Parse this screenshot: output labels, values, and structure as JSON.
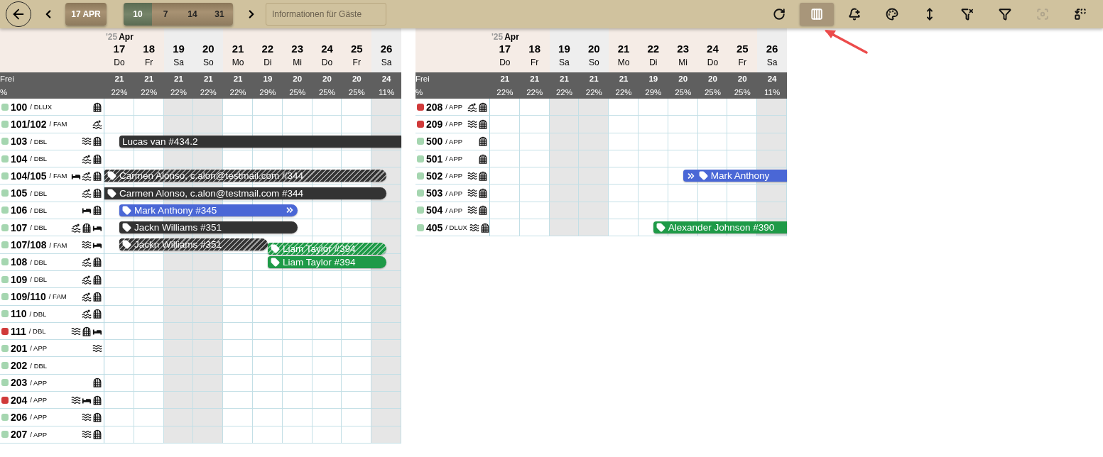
{
  "toolbar": {
    "date_button": "17 APR",
    "ranges": [
      {
        "label": "10",
        "selected": true
      },
      {
        "label": "7",
        "selected": false
      },
      {
        "label": "14",
        "selected": false
      },
      {
        "label": "31",
        "selected": false
      }
    ],
    "search": {
      "placeholder": "Informationen für Gäste"
    },
    "tools": [
      {
        "kind": "refresh",
        "selected": false,
        "disabled": false
      },
      {
        "kind": "columns",
        "selected": true,
        "disabled": false
      },
      {
        "kind": "bell-plus",
        "selected": false,
        "disabled": false
      },
      {
        "kind": "palette",
        "selected": false,
        "disabled": false
      },
      {
        "kind": "height",
        "selected": false,
        "disabled": false
      },
      {
        "kind": "filter-off",
        "selected": false,
        "disabled": false
      },
      {
        "kind": "filter",
        "selected": false,
        "disabled": false
      },
      {
        "kind": "focus",
        "selected": false,
        "disabled": true
      },
      {
        "kind": "replace",
        "selected": false,
        "disabled": false
      }
    ]
  },
  "calendars": [
    {
      "year": "'25",
      "month": "Apr",
      "free_label": "Frei",
      "percent_label": "%",
      "days": [
        {
          "date": "17",
          "weekday": "Do",
          "weekend": false,
          "free": "21",
          "percent": "22%"
        },
        {
          "date": "18",
          "weekday": "Fr",
          "weekend": false,
          "free": "21",
          "percent": "22%"
        },
        {
          "date": "19",
          "weekday": "Sa",
          "weekend": true,
          "free": "21",
          "percent": "22%"
        },
        {
          "date": "20",
          "weekday": "So",
          "weekend": true,
          "free": "21",
          "percent": "22%"
        },
        {
          "date": "21",
          "weekday": "Mo",
          "weekend": false,
          "free": "21",
          "percent": "22%"
        },
        {
          "date": "22",
          "weekday": "Di",
          "weekend": false,
          "free": "19",
          "percent": "29%"
        },
        {
          "date": "23",
          "weekday": "Mi",
          "weekend": false,
          "free": "20",
          "percent": "25%"
        },
        {
          "date": "24",
          "weekday": "Do",
          "weekend": false,
          "free": "20",
          "percent": "25%"
        },
        {
          "date": "25",
          "weekday": "Fr",
          "weekend": false,
          "free": "20",
          "percent": "25%"
        },
        {
          "date": "26",
          "weekday": "Sa",
          "weekend": true,
          "free": "24",
          "percent": "11%"
        }
      ],
      "rooms": [
        {
          "number": "100",
          "type": "/ DLUX",
          "color": "#a5d6b0",
          "features": [
            {
              "kind": "window"
            }
          ]
        },
        {
          "number": "101/102",
          "type": "/ FAM",
          "color": "#a5d6b0",
          "features": [
            {
              "kind": "pool"
            }
          ]
        },
        {
          "number": "103",
          "type": "/ DBL",
          "color": "#a5d6b0",
          "features": [
            {
              "kind": "waves"
            },
            {
              "kind": "window"
            }
          ],
          "bookings": [
            {
              "label": "Lucas van #434.2",
              "color": "#333333",
              "striped": false
            }
          ]
        },
        {
          "number": "104",
          "type": "/ DBL",
          "color": "#a5d6b0",
          "features": [
            {
              "kind": "pool"
            },
            {
              "kind": "window"
            }
          ]
        },
        {
          "number": "104/105",
          "type": "/ FAM",
          "color": "#a5d6b0",
          "features": [
            {
              "kind": "bed"
            },
            {
              "kind": "pool"
            },
            {
              "kind": "window"
            }
          ],
          "bookings": [
            {
              "label": "Carmen Alonso, c.alon@testmail.com #344",
              "color": "#333333",
              "striped": true,
              "tag": true
            }
          ]
        },
        {
          "number": "105",
          "type": "/ DBL",
          "color": "#a5d6b0",
          "features": [
            {
              "kind": "pool"
            },
            {
              "kind": "window"
            }
          ],
          "bookings": [
            {
              "label": "Carmen Alonso, c.alon@testmail.com #344",
              "color": "#333333",
              "striped": false,
              "tag": true
            }
          ]
        },
        {
          "number": "106",
          "type": "/ DBL",
          "color": "#a5d6b0",
          "features": [
            {
              "kind": "bed"
            },
            {
              "kind": "window"
            }
          ],
          "bookings": [
            {
              "label": "Mark Anthony #345",
              "color": "#4a67d6",
              "striped": false,
              "tag": true,
              "arrow_end": true
            }
          ]
        },
        {
          "number": "107",
          "type": "/ DBL",
          "color": "#a5d6b0",
          "features": [
            {
              "kind": "pool"
            },
            {
              "kind": "window"
            },
            {
              "kind": "bed"
            }
          ],
          "bookings": [
            {
              "label": "Jackn Williams #351",
              "color": "#333333",
              "striped": false,
              "tag": true
            }
          ]
        },
        {
          "number": "107/108",
          "type": "/ FAM",
          "color": "#a5d6b0",
          "features": [
            {
              "kind": "waves"
            },
            {
              "kind": "bed"
            }
          ],
          "bookings": [
            {
              "label": "Jackn Williams #351",
              "color": "#333333",
              "striped": true,
              "tag": true
            },
            {
              "label": "Liam Taylor #394",
              "color": "#1e9a47",
              "striped": true,
              "tag": true
            }
          ]
        },
        {
          "number": "108",
          "type": "/ DBL",
          "color": "#a5d6b0",
          "features": [
            {
              "kind": "pool"
            },
            {
              "kind": "window"
            }
          ],
          "bookings": [
            {
              "label": "Liam Taylor #394",
              "color": "#1e9a47",
              "striped": false,
              "tag": true
            }
          ]
        },
        {
          "number": "109",
          "type": "/ DBL",
          "color": "#a5d6b0",
          "features": [
            {
              "kind": "pool"
            },
            {
              "kind": "window"
            }
          ]
        },
        {
          "number": "109/110",
          "type": "/ FAM",
          "color": "#a5d6b0",
          "features": [
            {
              "kind": "pool"
            },
            {
              "kind": "window"
            }
          ]
        },
        {
          "number": "110",
          "type": "/ DBL",
          "color": "#a5d6b0",
          "features": [
            {
              "kind": "pool"
            },
            {
              "kind": "window"
            }
          ]
        },
        {
          "number": "111",
          "type": "/ DBL",
          "color": "#d03a3a",
          "features": [
            {
              "kind": "waves"
            },
            {
              "kind": "window"
            },
            {
              "kind": "bed"
            }
          ]
        },
        {
          "number": "201",
          "type": "/ APP",
          "color": "#a5d6b0",
          "features": [
            {
              "kind": "waves"
            }
          ]
        },
        {
          "number": "202",
          "type": "/ DBL",
          "color": "#a5d6b0"
        },
        {
          "number": "203",
          "type": "/ APP",
          "color": "#a5d6b0",
          "features": [
            {
              "kind": "window"
            }
          ]
        },
        {
          "number": "204",
          "type": "/ APP",
          "color": "#d03a3a",
          "features": [
            {
              "kind": "waves"
            },
            {
              "kind": "bed"
            },
            {
              "kind": "window"
            }
          ]
        },
        {
          "number": "206",
          "type": "/ APP",
          "color": "#a5d6b0",
          "features": [
            {
              "kind": "waves"
            },
            {
              "kind": "window"
            }
          ]
        },
        {
          "number": "207",
          "type": "/ APP",
          "color": "#a5d6b0",
          "features": [
            {
              "kind": "waves"
            },
            {
              "kind": "window"
            }
          ]
        }
      ]
    },
    {
      "year": "'25",
      "month": "Apr",
      "free_label": "Frei",
      "percent_label": "%",
      "days": [
        {
          "date": "17",
          "weekday": "Do",
          "weekend": false,
          "free": "21",
          "percent": "22%"
        },
        {
          "date": "18",
          "weekday": "Fr",
          "weekend": false,
          "free": "21",
          "percent": "22%"
        },
        {
          "date": "19",
          "weekday": "Sa",
          "weekend": true,
          "free": "21",
          "percent": "22%"
        },
        {
          "date": "20",
          "weekday": "So",
          "weekend": true,
          "free": "21",
          "percent": "22%"
        },
        {
          "date": "21",
          "weekday": "Mo",
          "weekend": false,
          "free": "21",
          "percent": "22%"
        },
        {
          "date": "22",
          "weekday": "Di",
          "weekend": false,
          "free": "19",
          "percent": "29%"
        },
        {
          "date": "23",
          "weekday": "Mi",
          "weekend": false,
          "free": "20",
          "percent": "25%"
        },
        {
          "date": "24",
          "weekday": "Do",
          "weekend": false,
          "free": "20",
          "percent": "25%"
        },
        {
          "date": "25",
          "weekday": "Fr",
          "weekend": false,
          "free": "20",
          "percent": "25%"
        },
        {
          "date": "26",
          "weekday": "Sa",
          "weekend": true,
          "free": "24",
          "percent": "11%"
        }
      ],
      "rooms": [
        {
          "number": "208",
          "type": "/ APP",
          "color": "#d03a3a",
          "features": [
            {
              "kind": "pool"
            },
            {
              "kind": "window"
            }
          ]
        },
        {
          "number": "209",
          "type": "/ APP",
          "color": "#d03a3a",
          "features": [
            {
              "kind": "waves"
            },
            {
              "kind": "window"
            }
          ]
        },
        {
          "number": "500",
          "type": "/ APP",
          "color": "#a5d6b0",
          "features": [
            {
              "kind": "window"
            }
          ]
        },
        {
          "number": "501",
          "type": "/ APP",
          "color": "#a5d6b0",
          "features": [
            {
              "kind": "window"
            }
          ]
        },
        {
          "number": "502",
          "type": "/ APP",
          "color": "#a5d6b0",
          "features": [
            {
              "kind": "waves"
            },
            {
              "kind": "window"
            }
          ],
          "bookings": [
            {
              "label": "Mark Anthony",
              "color": "#4a67d6",
              "striped": false,
              "tag": true,
              "arrow_start": true
            }
          ]
        },
        {
          "number": "503",
          "type": "/ APP",
          "color": "#a5d6b0",
          "features": [
            {
              "kind": "waves"
            },
            {
              "kind": "window"
            }
          ]
        },
        {
          "number": "504",
          "type": "/ APP",
          "color": "#a5d6b0",
          "features": [
            {
              "kind": "waves"
            },
            {
              "kind": "window"
            }
          ]
        },
        {
          "number": "405",
          "type": "/ DLUX",
          "color": "#a5d6b0",
          "features": [
            {
              "kind": "waves"
            },
            {
              "kind": "window"
            }
          ],
          "bookings": [
            {
              "label": "Alexander Johnson #390",
              "color": "#1e9a47",
              "striped": false,
              "tag": true
            }
          ]
        }
      ]
    }
  ]
}
